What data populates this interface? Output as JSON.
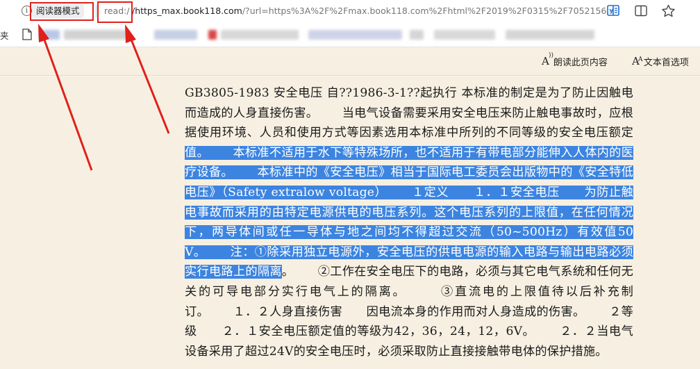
{
  "address_bar": {
    "reader_mode_label": "阅读器模式",
    "url_scheme": "read:/",
    "url_host": "/https_max.book118.com",
    "url_rest": "/?url=https%3A%2F%2Fmax.book118.com%2Fhtml%2F2019%2F0315%2F7052156...",
    "info_icon_glyph": "i"
  },
  "bookmarks_bar": {
    "fragment_label": "夹"
  },
  "reader_toolbar": {
    "read_aloud_label": "朗读此页内容",
    "text_prefs_label": "文本首选项",
    "read_aloud_glyph": "A",
    "text_prefs_glyph": "A"
  },
  "article": {
    "text_before_selection": "GB3805-1983 安全电压 自??1986-3-1??起执行 本标准的制定是为了防止因触电而造成的人身直接伤害。      当电气设备需要采用安全电压来防止触电事故时，应根据使用环境、人员和使用方式等因素选用本标准中所列的不同等级的安全电压额定",
    "selected_text": "值。      本标准不适用于水下等特殊场所，也不适用于有带电部分能伸入人体内的医疗设备。      本标准中的《安全电压》相当于国际电工委员会出版物中的《安全特低电压》（Safety extralow voltage）      １定义      １．１安全电压      为防止触电事故而采用的由特定电源供电的电压系列。这个电压系列的上限值，在任何情况下，两导体间或任一导体与地之间均不得超过交流（50~500Hz）有效值50V。      注：①除采用独立电源外，安全电压的供电电源的输入电路与输出电路必须实行电路上的隔离",
    "text_after_selection": "。      ②工作在安全电压下的电路，必须与其它电气系统和任何无关的可导电部分实行电气上的隔离。      ③直流电的上限值待以后补充制订。      １．２人身直接伤害      因电流本身的作用而对人身造成的伤害。      ２等级      ２．１安全电压额定值的等级为42，36，24，12，6V。      ２．２当电气设备采用了超过24V的安全电压时，必须采取防止直接接触带电体的保护措施。"
  },
  "colors": {
    "reader_background": "#f7f0e2",
    "selection": "#3c84e0",
    "annotation_red": "#e0201b"
  },
  "icons": [
    "info-icon",
    "immersive-reader-icon",
    "split-screen-icon",
    "favorite-star-icon",
    "page-icon",
    "read-aloud-icon",
    "text-preferences-icon"
  ]
}
